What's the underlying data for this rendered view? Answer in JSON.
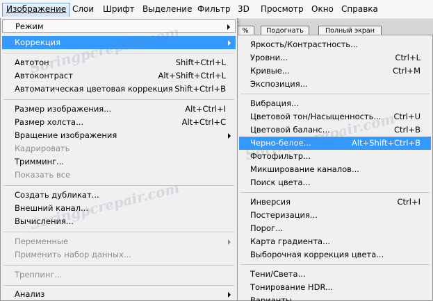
{
  "menubar": {
    "items": [
      {
        "label": "Изображение",
        "active": true
      },
      {
        "label": "Слои"
      },
      {
        "label": "Шрифт"
      },
      {
        "label": "Выделение"
      },
      {
        "label": "Фильтр"
      },
      {
        "label": "3D"
      },
      {
        "label": "Просмотр"
      },
      {
        "label": "Окно"
      },
      {
        "label": "Справка"
      }
    ]
  },
  "toolbar": {
    "fit_label": "Подогнать",
    "fullscreen_label": "Полный экран",
    "partial_label": "%"
  },
  "image_menu": {
    "items": [
      {
        "label": "Режим",
        "submenu": true
      },
      {
        "label": "Коррекция",
        "submenu": true,
        "highlighted": true
      },
      {
        "label": "Автотон",
        "shortcut": "Shift+Ctrl+L"
      },
      {
        "label": "Автоконтраст",
        "shortcut": "Alt+Shift+Ctrl+L"
      },
      {
        "label": "Автоматическая цветовая коррекция",
        "shortcut": "Shift+Ctrl+B"
      },
      {
        "label": "Размер изображения...",
        "shortcut": "Alt+Ctrl+I"
      },
      {
        "label": "Размер холста...",
        "shortcut": "Alt+Ctrl+C"
      },
      {
        "label": "Вращение изображения",
        "submenu": true
      },
      {
        "label": "Кадрировать",
        "disabled": true
      },
      {
        "label": "Тримминг..."
      },
      {
        "label": "Показать все",
        "disabled": true
      },
      {
        "label": "Создать дубликат..."
      },
      {
        "label": "Внешний канал..."
      },
      {
        "label": "Вычисления..."
      },
      {
        "label": "Переменные",
        "disabled": true,
        "submenu": true
      },
      {
        "label": "Применить набор данных...",
        "disabled": true
      },
      {
        "label": "Треппинг...",
        "disabled": true
      },
      {
        "label": "Анализ",
        "submenu": true
      }
    ]
  },
  "correction_menu": {
    "items": [
      {
        "label": "Яркость/Контрастность..."
      },
      {
        "label": "Уровни...",
        "shortcut": "Ctrl+L"
      },
      {
        "label": "Кривые...",
        "shortcut": "Ctrl+M"
      },
      {
        "label": "Экспозиция..."
      },
      {
        "label": "Вибрация..."
      },
      {
        "label": "Цветовой тон/Насыщенность...",
        "shortcut": "Ctrl+U"
      },
      {
        "label": "Цветовой баланс...",
        "shortcut": "Ctrl+B"
      },
      {
        "label": "Черно-белое...",
        "shortcut": "Alt+Shift+Ctrl+B",
        "highlighted": true
      },
      {
        "label": "Фотофильтр..."
      },
      {
        "label": "Микширование каналов..."
      },
      {
        "label": "Поиск цвета..."
      },
      {
        "label": "Инверсия",
        "shortcut": "Ctrl+I"
      },
      {
        "label": "Постеризация..."
      },
      {
        "label": "Порог..."
      },
      {
        "label": "Карта градиента..."
      },
      {
        "label": "Выборочная коррекция цвета..."
      },
      {
        "label": "Тени/Света..."
      },
      {
        "label": "Тонирование HDR..."
      },
      {
        "label": "Варианты..."
      }
    ]
  },
  "colors": {
    "highlight": "#3399ff",
    "menu_bg": "#f0f0f0",
    "disabled_text": "#8c8c8c"
  }
}
